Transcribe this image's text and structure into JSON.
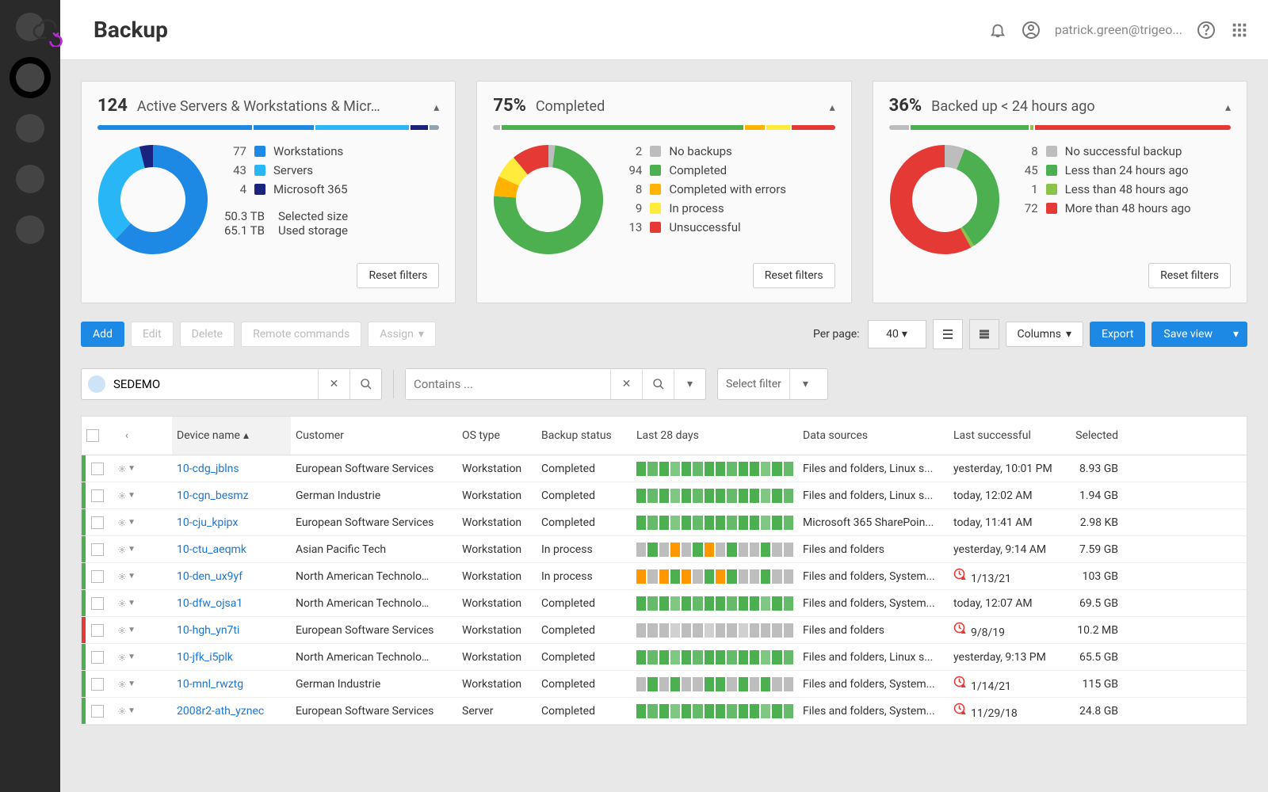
{
  "header": {
    "title": "Backup",
    "user_email": "patrick.green@trigeo..."
  },
  "cards": [
    {
      "big": "124",
      "label": "Active Servers & Workstations & Micr…",
      "bars": [
        [
          "#1e88e5",
          46
        ],
        [
          "#1e88e5",
          18
        ],
        [
          "#29b6f6",
          28
        ],
        [
          "#1a237e",
          5
        ],
        [
          "#90a4ae",
          3
        ]
      ],
      "donut": [
        [
          "#1e88e5",
          62
        ],
        [
          "#29b6f6",
          34
        ],
        [
          "#1a237e",
          4
        ]
      ],
      "legend": [
        [
          "77",
          "#1e88e5",
          "Workstations"
        ],
        [
          "43",
          "#29b6f6",
          "Servers"
        ],
        [
          "4",
          "#1a237e",
          "Microsoft 365"
        ]
      ],
      "stats": [
        [
          "50.3 TB",
          "Selected size"
        ],
        [
          "65.1 TB",
          "Used storage"
        ]
      ],
      "reset": "Reset filters"
    },
    {
      "big": "75%",
      "label": "Completed",
      "bars": [
        [
          "#bdbdbd",
          2
        ],
        [
          "#4caf50",
          72
        ],
        [
          "#ffb300",
          6
        ],
        [
          "#ffeb3b",
          7
        ],
        [
          "#e53935",
          13
        ]
      ],
      "donut": [
        [
          "#bdbdbd",
          2
        ],
        [
          "#4caf50",
          74
        ],
        [
          "#ffb300",
          6
        ],
        [
          "#ffeb3b",
          7
        ],
        [
          "#e53935",
          11
        ]
      ],
      "legend": [
        [
          "2",
          "#bdbdbd",
          "No backups"
        ],
        [
          "94",
          "#4caf50",
          "Completed"
        ],
        [
          "8",
          "#ffb300",
          "Completed with errors"
        ],
        [
          "9",
          "#ffeb3b",
          "In process"
        ],
        [
          "13",
          "#e53935",
          "Unsuccessful"
        ]
      ],
      "reset": "Reset filters"
    },
    {
      "big": "36%",
      "label": "Backed up < 24 hours ago",
      "bars": [
        [
          "#bdbdbd",
          6
        ],
        [
          "#4caf50",
          35
        ],
        [
          "#8bc34a",
          1
        ],
        [
          "#e53935",
          58
        ]
      ],
      "donut": [
        [
          "#bdbdbd",
          6
        ],
        [
          "#4caf50",
          35
        ],
        [
          "#8bc34a",
          1
        ],
        [
          "#e53935",
          58
        ]
      ],
      "legend": [
        [
          "8",
          "#bdbdbd",
          "No successful backup"
        ],
        [
          "45",
          "#4caf50",
          "Less than 24 hours ago"
        ],
        [
          "1",
          "#8bc34a",
          "Less than 48 hours ago"
        ],
        [
          "72",
          "#e53935",
          "More than 48 hours ago"
        ]
      ],
      "reset": "Reset filters"
    }
  ],
  "toolbar": {
    "add": "Add",
    "edit": "Edit",
    "delete": "Delete",
    "remote": "Remote commands",
    "assign": "Assign",
    "per_page_label": "Per page:",
    "per_page_value": "40",
    "columns": "Columns",
    "export": "Export",
    "save_view": "Save view"
  },
  "filters": {
    "search_value": "SEDEMO",
    "contains_placeholder": "Contains ...",
    "select_filter": "Select filter"
  },
  "columns": [
    "Device name",
    "Customer",
    "OS type",
    "Backup status",
    "Last 28 days",
    "Data sources",
    "Last successful",
    "Selected"
  ],
  "rows": [
    {
      "stripe": "#4caf50",
      "name": "10-cdg_jblns",
      "customer": "European Software Services",
      "os": "Workstation",
      "status": "Completed",
      "spark": "g",
      "ds": "Files and folders, Linux s...",
      "last": "yesterday, 10:01 PM",
      "warn": false,
      "sel": "8.93 GB"
    },
    {
      "stripe": "#4caf50",
      "name": "10-cgn_besmz",
      "customer": "German Industrie",
      "os": "Workstation",
      "status": "Completed",
      "spark": "g",
      "ds": "Files and folders, Linux s...",
      "last": "today, 12:02 AM",
      "warn": false,
      "sel": "1.94 GB"
    },
    {
      "stripe": "#4caf50",
      "name": "10-cju_kpipx",
      "customer": "European Software Services",
      "os": "Workstation",
      "status": "Completed",
      "spark": "g",
      "ds": "Microsoft 365 SharePoin...",
      "last": "today, 11:41 AM",
      "warn": false,
      "sel": "2.98 KB"
    },
    {
      "stripe": "#4caf50",
      "name": "10-ctu_aeqmk",
      "customer": "Asian Pacific Tech",
      "os": "Workstation",
      "status": "In process",
      "spark": "m",
      "ds": "Files and folders",
      "last": "yesterday, 9:14 AM",
      "warn": false,
      "sel": "7.59 GB"
    },
    {
      "stripe": "#4caf50",
      "name": "10-den_ux9yf",
      "customer": "North American Technolo…",
      "os": "Workstation",
      "status": "In process",
      "spark": "o",
      "ds": "Files and folders, System...",
      "last": "1/13/21",
      "warn": true,
      "sel": "103 GB"
    },
    {
      "stripe": "#4caf50",
      "name": "10-dfw_ojsa1",
      "customer": "North American Technolo…",
      "os": "Workstation",
      "status": "Completed",
      "spark": "g",
      "ds": "Files and folders, System...",
      "last": "today, 12:07 AM",
      "warn": false,
      "sel": "69.5 GB"
    },
    {
      "stripe": "#e53935",
      "name": "10-hgh_yn7ti",
      "customer": "European Software Services",
      "os": "Workstation",
      "status": "Completed",
      "spark": "e",
      "ds": "Files and folders",
      "last": "9/8/19",
      "warn": true,
      "sel": "10.2 MB"
    },
    {
      "stripe": "#4caf50",
      "name": "10-jfk_i5plk",
      "customer": "North American Technolo…",
      "os": "Workstation",
      "status": "Completed",
      "spark": "g",
      "ds": "Files and folders, Linux s...",
      "last": "yesterday, 9:13 PM",
      "warn": false,
      "sel": "65.5 GB"
    },
    {
      "stripe": "#4caf50",
      "name": "10-mnl_rwztg",
      "customer": "German Industrie",
      "os": "Workstation",
      "status": "Completed",
      "spark": "p",
      "ds": "Files and folders, System...",
      "last": "1/14/21",
      "warn": true,
      "sel": "115 GB"
    },
    {
      "stripe": "#4caf50",
      "name": "2008r2-ath_yznec",
      "customer": "European Software Services",
      "os": "Server",
      "status": "Completed",
      "spark": "g",
      "ds": "Files and folders, System...",
      "last": "11/29/18",
      "warn": true,
      "sel": "24.8 GB"
    }
  ],
  "chart_data": [
    {
      "type": "pie",
      "title": "Active Servers & Workstations & Microsoft 365",
      "series": [
        {
          "name": "Workstations",
          "value": 77
        },
        {
          "name": "Servers",
          "value": 43
        },
        {
          "name": "Microsoft 365",
          "value": 4
        }
      ]
    },
    {
      "type": "pie",
      "title": "Completed",
      "series": [
        {
          "name": "No backups",
          "value": 2
        },
        {
          "name": "Completed",
          "value": 94
        },
        {
          "name": "Completed with errors",
          "value": 8
        },
        {
          "name": "In process",
          "value": 9
        },
        {
          "name": "Unsuccessful",
          "value": 13
        }
      ]
    },
    {
      "type": "pie",
      "title": "Backed up < 24 hours ago",
      "series": [
        {
          "name": "No successful backup",
          "value": 8
        },
        {
          "name": "Less than 24 hours ago",
          "value": 45
        },
        {
          "name": "Less than 48 hours ago",
          "value": 1
        },
        {
          "name": "More than 48 hours ago",
          "value": 72
        }
      ]
    }
  ]
}
